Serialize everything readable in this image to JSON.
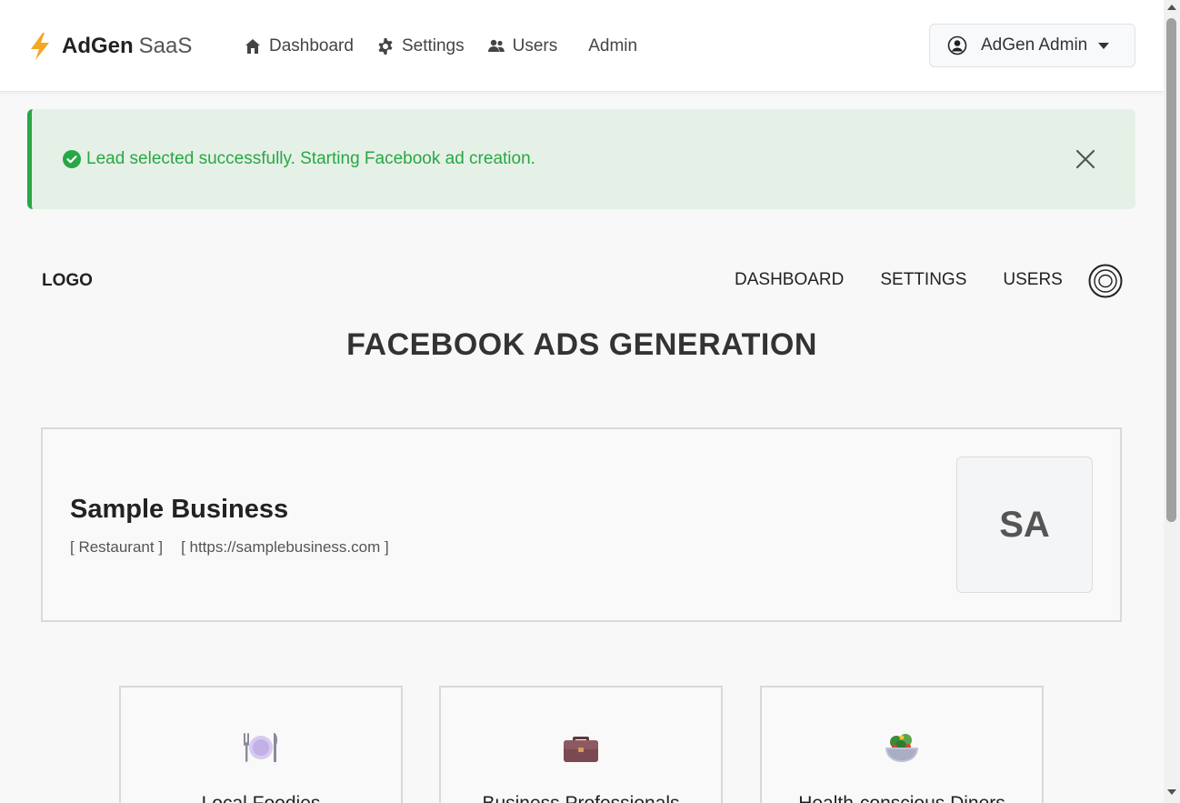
{
  "navbar": {
    "brand_bold": "AdGen",
    "brand_light": "SaaS",
    "links": {
      "dashboard": "Dashboard",
      "settings": "Settings",
      "users": "Users",
      "admin": "Admin"
    },
    "user_menu_label": "AdGen Admin"
  },
  "alert": {
    "message": "Lead selected successfully. Starting Facebook ad creation.",
    "color": "#28a745"
  },
  "inner_header": {
    "logo": "LOGO",
    "links": [
      "DASHBOARD",
      "SETTINGS",
      "USERS"
    ]
  },
  "page_title": "FACEBOOK ADS GENERATION",
  "business": {
    "name": "Sample Business",
    "category": "[ Restaurant ]",
    "website": "[ https://samplebusiness.com ]",
    "initials": "SA"
  },
  "audiences": [
    {
      "title": "Local Foodies",
      "icon": "plate-icon"
    },
    {
      "title": "Business Professionals",
      "icon": "briefcase-icon"
    },
    {
      "title": "Health-conscious Diners",
      "icon": "salad-icon"
    }
  ]
}
